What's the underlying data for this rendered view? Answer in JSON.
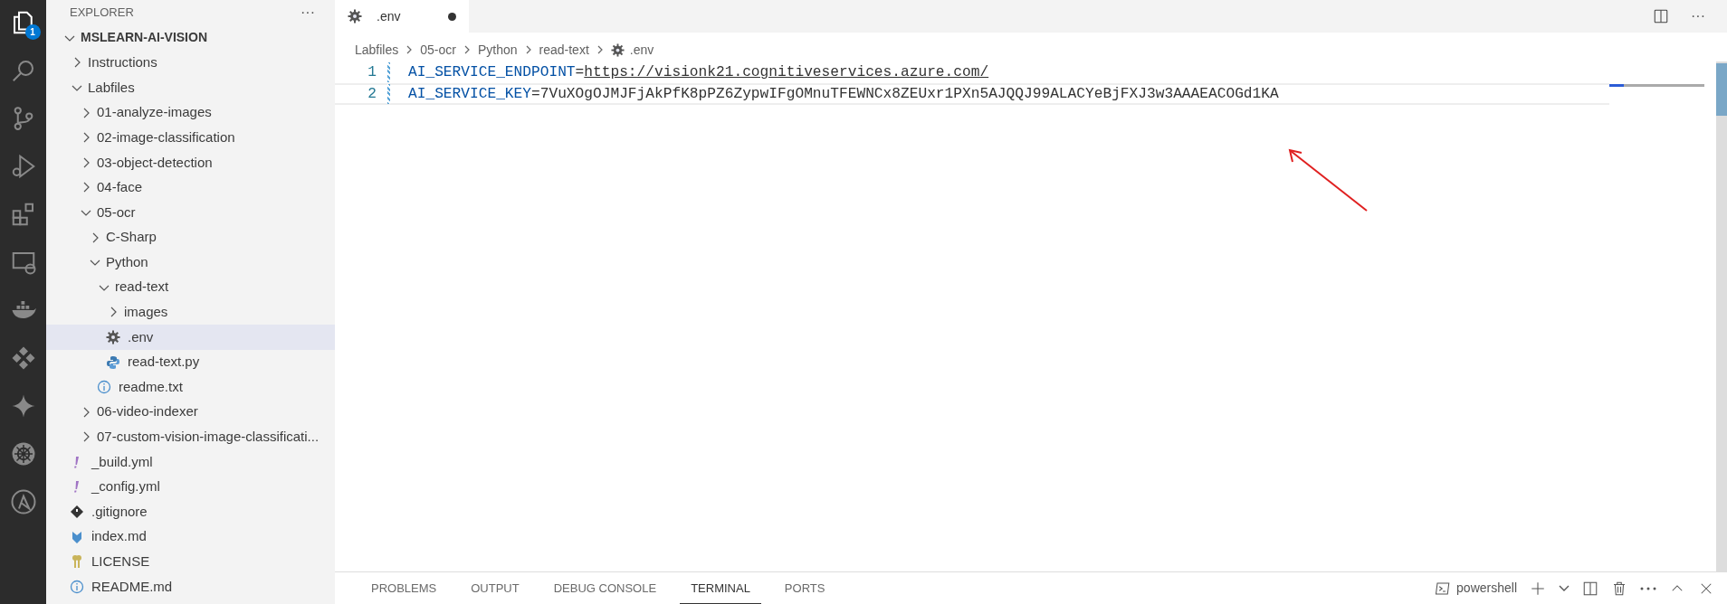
{
  "activity_bar": {
    "items": [
      {
        "kind": "explorer",
        "selected": true,
        "badge": "1"
      },
      {
        "kind": "search",
        "selected": false
      },
      {
        "kind": "source-control",
        "selected": false
      },
      {
        "kind": "run-debug",
        "selected": false
      },
      {
        "kind": "extensions",
        "selected": false
      },
      {
        "kind": "remote",
        "selected": false
      },
      {
        "kind": "docker",
        "selected": false
      },
      {
        "kind": "diamonds",
        "selected": false
      },
      {
        "kind": "sparkle",
        "selected": false
      },
      {
        "kind": "helm",
        "selected": false
      },
      {
        "kind": "ansible",
        "selected": false
      }
    ]
  },
  "sidebar": {
    "title": "EXPLORER",
    "more": "···",
    "tree": {
      "label": "MSLEARN-AI-VISION",
      "kind": "folder",
      "expanded": true,
      "selected": false,
      "children": [
        {
          "label": "Instructions",
          "kind": "folder",
          "expanded": false,
          "selected": false
        },
        {
          "label": "Labfiles",
          "kind": "folder",
          "expanded": true,
          "selected": false,
          "children": [
            {
              "label": "01-analyze-images",
              "kind": "folder",
              "expanded": false,
              "selected": false
            },
            {
              "label": "02-image-classification",
              "kind": "folder",
              "expanded": false,
              "selected": false
            },
            {
              "label": "03-object-detection",
              "kind": "folder",
              "expanded": false,
              "selected": false
            },
            {
              "label": "04-face",
              "kind": "folder",
              "expanded": false,
              "selected": false
            },
            {
              "label": "05-ocr",
              "kind": "folder",
              "expanded": true,
              "selected": false,
              "children": [
                {
                  "label": "C-Sharp",
                  "kind": "folder",
                  "expanded": false,
                  "selected": false
                },
                {
                  "label": "Python",
                  "kind": "folder",
                  "expanded": true,
                  "selected": false,
                  "children": [
                    {
                      "label": "read-text",
                      "kind": "folder",
                      "expanded": true,
                      "selected": false,
                      "children": [
                        {
                          "label": "images",
                          "kind": "folder",
                          "expanded": false,
                          "selected": false
                        },
                        {
                          "label": ".env",
                          "kind": "settings-file",
                          "selected": true
                        },
                        {
                          "label": "read-text.py",
                          "kind": "python-file",
                          "selected": false
                        }
                      ]
                    },
                    {
                      "label": "readme.txt",
                      "kind": "info-file",
                      "selected": false
                    }
                  ]
                }
              ]
            },
            {
              "label": "06-video-indexer",
              "kind": "folder",
              "expanded": false,
              "selected": false
            },
            {
              "label": "07-custom-vision-image-classificati...",
              "kind": "folder",
              "expanded": false,
              "selected": false
            }
          ]
        },
        {
          "label": "_build.yml",
          "kind": "yaml-file",
          "selected": false
        },
        {
          "label": "_config.yml",
          "kind": "yaml-file",
          "selected": false
        },
        {
          "label": ".gitignore",
          "kind": "git-file",
          "selected": false
        },
        {
          "label": "index.md",
          "kind": "markdown-file",
          "selected": false
        },
        {
          "label": "LICENSE",
          "kind": "license-file",
          "selected": false
        },
        {
          "label": "README.md",
          "kind": "info-file",
          "selected": false
        }
      ]
    }
  },
  "editor": {
    "tabs": [
      {
        "label": ".env",
        "selected": true,
        "modified": true
      }
    ],
    "breadcrumbs": [
      "Labfiles",
      "05-ocr",
      "Python",
      "read-text",
      ".env"
    ],
    "lines": [
      {
        "number": "1",
        "key": "AI_SERVICE_ENDPOINT",
        "sep": "=",
        "value": "https://visionk21.cognitiveservices.azure.com/",
        "link": true,
        "current": false
      },
      {
        "number": "2",
        "key": "AI_SERVICE_KEY",
        "sep": "=",
        "value": "7VuXOgOJMJFjAkPfK8pPZ6ZypwIFgOMnuTFEWNCx8ZEUxr1PXn5AJQQJ99ALACYeBjFXJ3w3AAAEACOGd1KA",
        "link": false,
        "current": true
      }
    ]
  },
  "panel": {
    "tabs": [
      {
        "label": "PROBLEMS",
        "selected": false
      },
      {
        "label": "OUTPUT",
        "selected": false
      },
      {
        "label": "DEBUG CONSOLE",
        "selected": false
      },
      {
        "label": "TERMINAL",
        "selected": true
      },
      {
        "label": "PORTS",
        "selected": false
      }
    ],
    "terminal": "powershell"
  }
}
